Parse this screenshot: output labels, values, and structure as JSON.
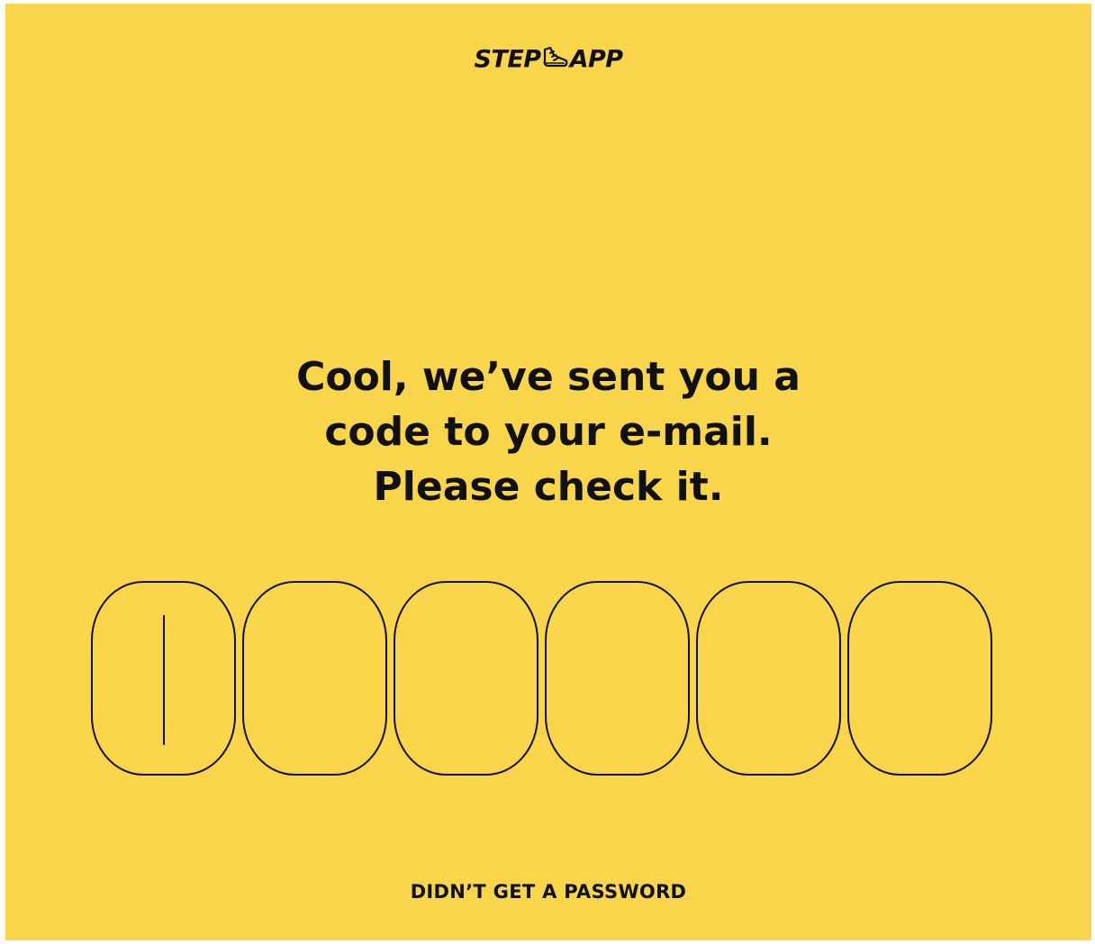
{
  "logo": {
    "left_text": "STEP",
    "right_text": "APP",
    "icon": "sneaker-icon"
  },
  "headline": {
    "line1": "Cool, we’ve sent you a",
    "line2": "code to your e-mail.",
    "line3": "Please check it."
  },
  "code": {
    "length": 6,
    "digits": [
      "",
      "",
      "",
      "",
      "",
      ""
    ],
    "active_index": 0
  },
  "resend_link": "DIDN’T GET A PASSWORD",
  "colors": {
    "background": "#F8D54B",
    "ink": "#111111"
  }
}
